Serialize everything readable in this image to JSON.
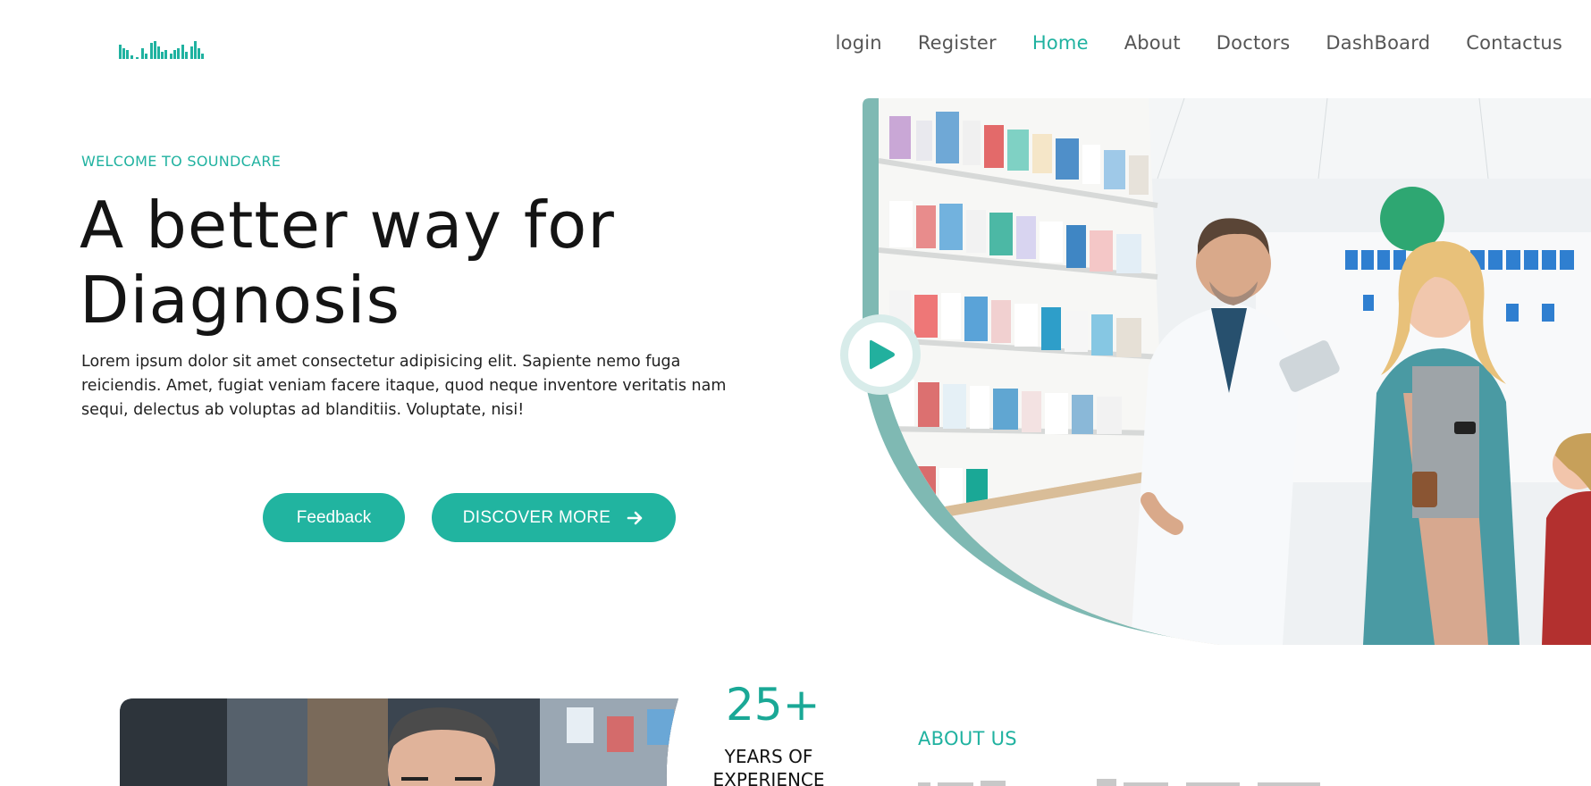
{
  "nav": {
    "logo_icon": "soundwave-logo-icon",
    "items": [
      {
        "label": "login"
      },
      {
        "label": "Register"
      },
      {
        "label": "Home",
        "active": true
      },
      {
        "label": "About"
      },
      {
        "label": "Doctors"
      },
      {
        "label": "DashBoard"
      },
      {
        "label": "Contactus"
      }
    ]
  },
  "hero": {
    "eyebrow": "WELCOME TO SOUNDCARE",
    "title_line1": "A better way for",
    "title_line2": "Diagnosis",
    "body": "Lorem ipsum dolor sit amet consectetur adipisicing elit. Sapiente nemo fuga reiciendis. Amet, fugiat veniam facere itaque, quod neque inventore veritatis nam sequi, delectus ab voluptas ad blanditiis. Voluptate, nisi!",
    "feedback_label": "Feedback",
    "discover_label": "DISCOVER MORE",
    "discover_icon": "arrow-right-icon",
    "play_icon": "play-icon"
  },
  "about": {
    "stat_value": "25+",
    "stat_label_line1": "YEARS OF",
    "stat_label_line2": "EXPERIENCE",
    "section_title": "ABOUT US"
  },
  "colors": {
    "accent": "#20b2a0",
    "text": "#141414",
    "nav_text": "#555555"
  }
}
